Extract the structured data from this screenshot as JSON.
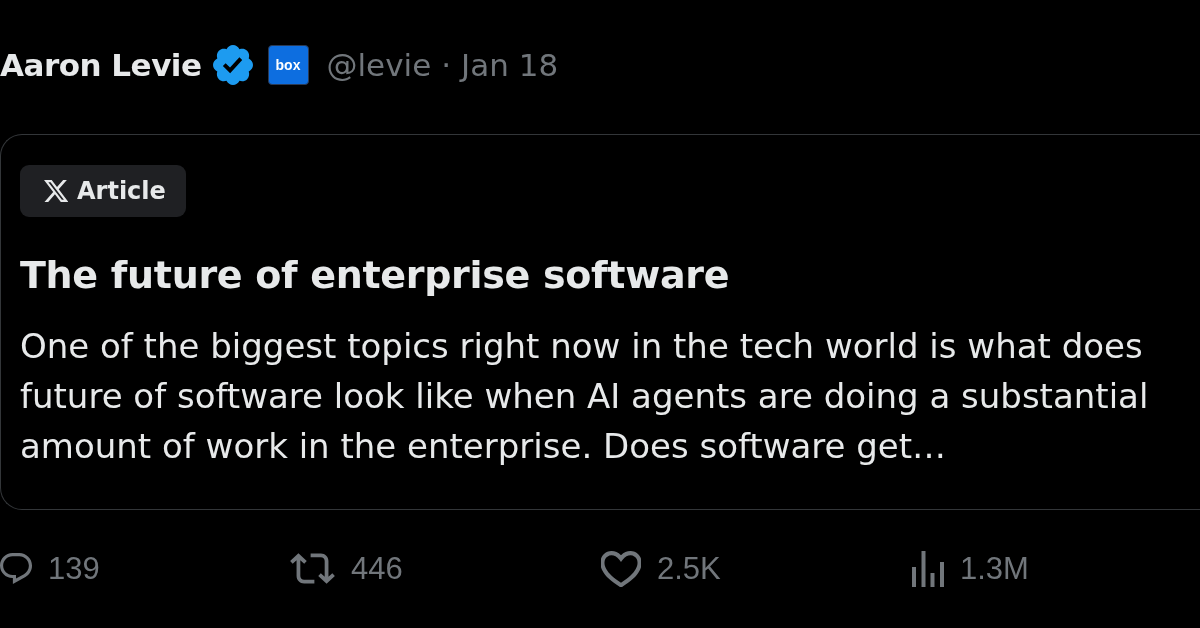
{
  "author": {
    "name": "Aaron Levie",
    "verified": true,
    "affiliate_badge": "box",
    "handle": "@levie",
    "separator": "·",
    "date": "Jan 18"
  },
  "article": {
    "tag": "Article",
    "title": "The future of enterprise software",
    "summary": "One of the biggest topics right now in the tech world is what does\nfuture of software look like when AI agents are doing a substantial\namount of work in the enterprise. Does software get…"
  },
  "actions": [
    {
      "kind": "reply",
      "count": "139"
    },
    {
      "kind": "repost",
      "count": "446"
    },
    {
      "kind": "like",
      "count": "2.5K"
    },
    {
      "kind": "views",
      "count": "1.3M"
    }
  ]
}
